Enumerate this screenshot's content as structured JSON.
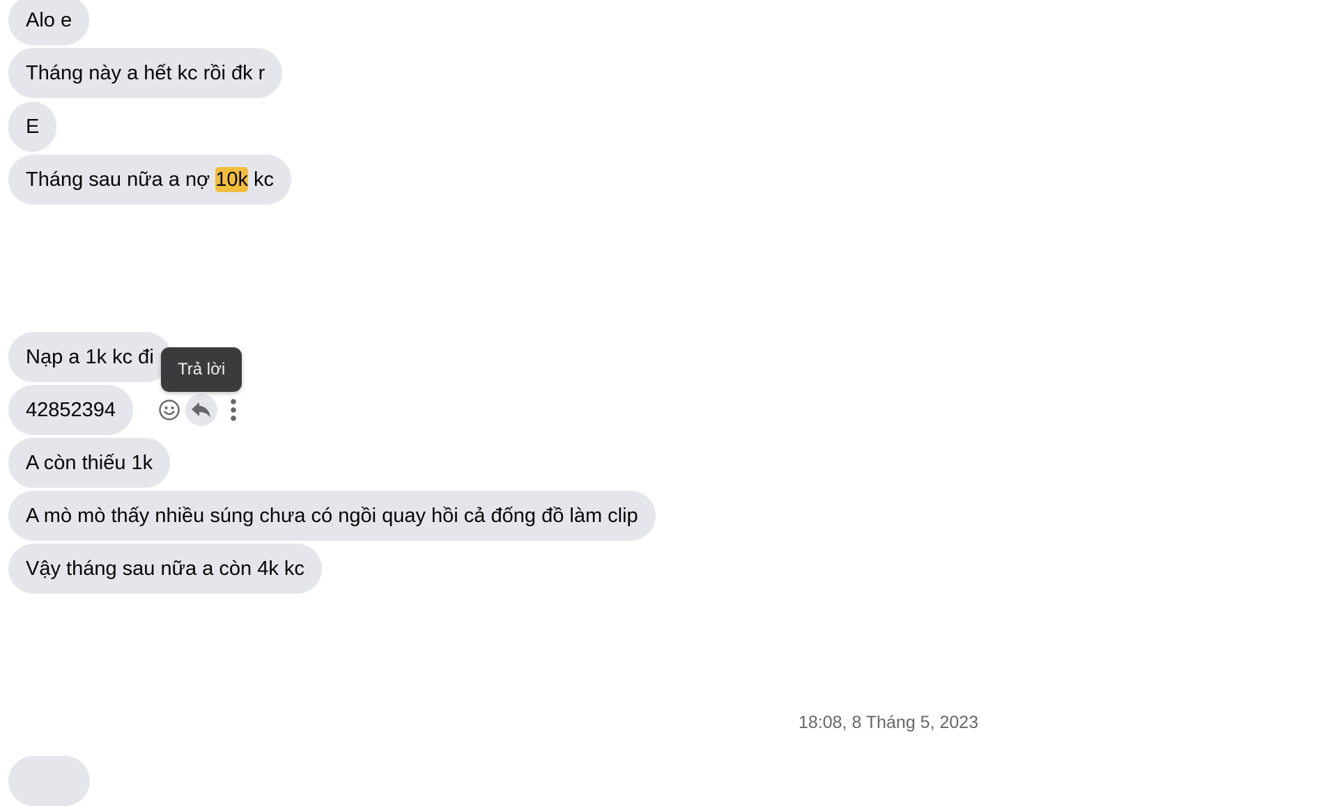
{
  "messages": [
    {
      "text": "Alo e"
    },
    {
      "text": "Tháng này a hết kc rồi đk r"
    },
    {
      "text": "E"
    },
    {
      "text_before": "Tháng sau nữa a nợ ",
      "highlight": "10k",
      "text_after": " kc"
    },
    {
      "text": "Nạp a 1k kc đi"
    },
    {
      "text": "42852394"
    },
    {
      "text": "A còn thiếu 1k"
    },
    {
      "text": "A mò mò thấy nhiều súng chưa có ngồi quay hồi cả đống đồ làm clip"
    },
    {
      "text": "Vậy tháng sau nữa a còn 4k kc"
    }
  ],
  "tooltip": {
    "label": "Trả lời"
  },
  "message_actions": {
    "react_icon": "smiley-icon",
    "reply_icon": "reply-arrow-icon",
    "more_icon": "more-vertical-icon"
  },
  "timestamp": "18:08, 8 Tháng 5, 2023",
  "colors": {
    "bubble": "#e4e6eb",
    "highlight": "#f2bd3b",
    "tooltip": "#3a3b3c",
    "timestamp": "#65676b"
  }
}
